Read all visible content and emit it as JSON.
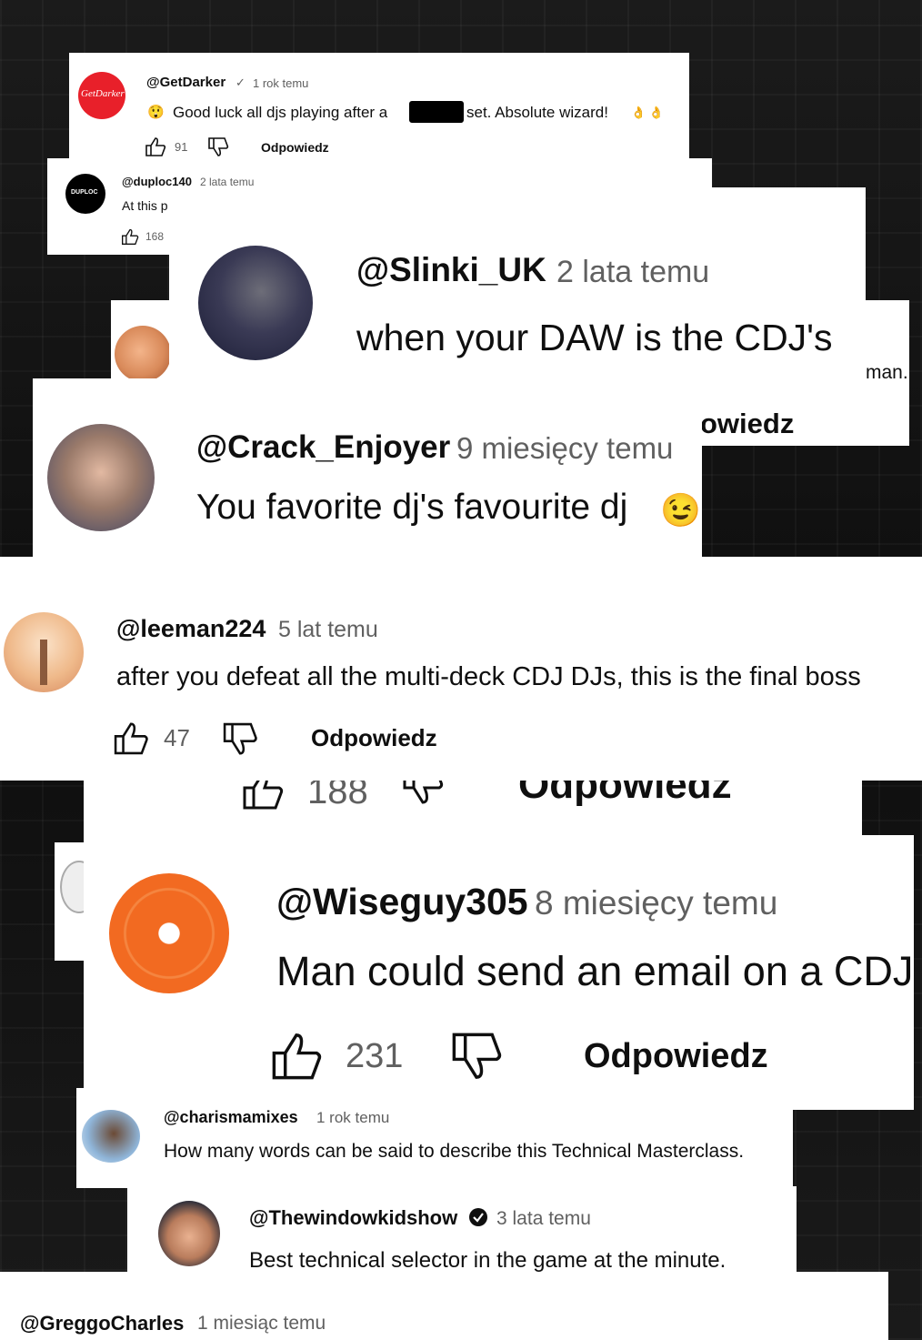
{
  "comments": {
    "getdarker": {
      "avatar_text": "GetDarker",
      "handle": "@GetDarker",
      "verified_mark": "✓",
      "time": "1 rok temu",
      "emoji": "😲",
      "text_before": "Good luck all djs playing after a",
      "text_after": "set.  Absolute wizard!",
      "trailing_emoji": "👌 👌",
      "likes": "91",
      "reply": "Odpowiedz"
    },
    "duploc": {
      "avatar_text": "DUPLOC",
      "handle": "@duploc140",
      "time": "2 lata temu",
      "text": "At this p",
      "likes": "168"
    },
    "slinki": {
      "handle": "@Slinki_UK",
      "time": "2 lata temu",
      "text": "when your DAW is the CDJ's"
    },
    "fragments": {
      "man_text": "man.",
      "owiedz_text": "owiedz",
      "cut_likes": "188",
      "cut_reply": "Odpowiedz"
    },
    "crack": {
      "handle": "@Crack_Enjoyer",
      "time": "9 miesięcy temu",
      "text": "You favorite dj's favourite dj",
      "emoji": "😉"
    },
    "leeman": {
      "handle": "@leeman224",
      "time": "5 lat temu",
      "text": "after you defeat all the multi-deck CDJ DJs, this is the final boss",
      "likes": "47",
      "reply": "Odpowiedz"
    },
    "wiseguy": {
      "handle": "@Wiseguy305",
      "time": "8 miesięcy temu",
      "text": "Man could send an email on a CDJ",
      "likes": "231",
      "reply": "Odpowiedz"
    },
    "charisma": {
      "handle": "@charismamixes",
      "time": "1 rok temu",
      "text": "How many words can be said to describe this Technical Masterclass."
    },
    "thewindow": {
      "handle": "@Thewindowkidshow",
      "time": "3 lata temu",
      "text": "Best technical selector in the game at the minute."
    },
    "greggo": {
      "handle": "@GreggoCharles",
      "time": "1 miesiąc temu"
    }
  },
  "colors": {
    "getdarker_avatar": "#e8202a",
    "duploc_avatar": "#000000",
    "vinyl_orange": "#f26a21",
    "emoji_yellow": "#f7c324"
  },
  "icons": [
    "thumbs-up-icon",
    "thumbs-down-icon",
    "verified-check-icon"
  ]
}
